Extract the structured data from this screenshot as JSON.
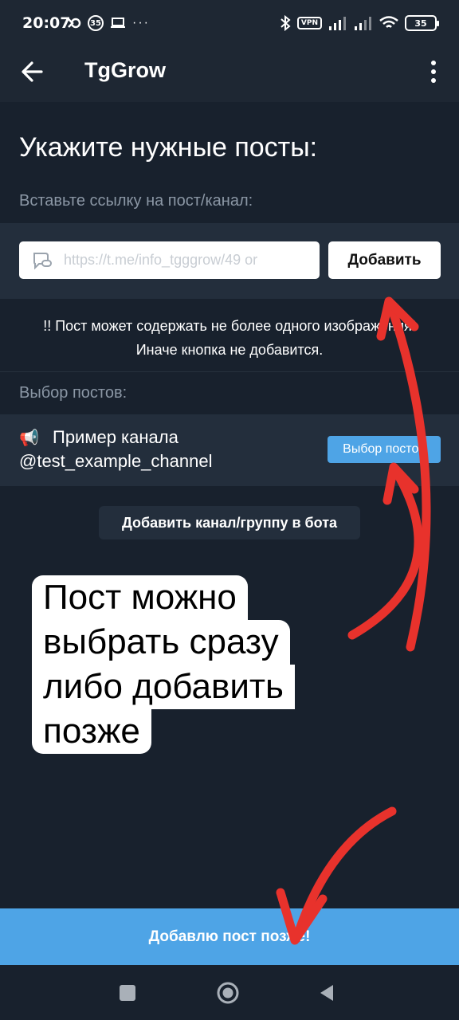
{
  "status_bar": {
    "time": "20:07",
    "circle_badge": "35",
    "vpn": "VPN",
    "battery": "35",
    "more": "···"
  },
  "app_bar": {
    "title": "TgGrow"
  },
  "page": {
    "heading": "Укажите нужные посты:",
    "link_label": "Вставьте ссылку на пост/канал:",
    "link_placeholder": "https://t.me/info_tgggrow/49 or",
    "add_button": "Добавить",
    "notice_line1": "!! Пост может содержать не более одного изображения!",
    "notice_line2": "Иначе кнопка не добавится.",
    "posts_label": "Выбор постов:",
    "channel": {
      "icon": "📢",
      "name": "Пример канала",
      "handle": "@test_example_channel",
      "select_button": "Выбор постов"
    },
    "add_channel_button": "Добавить канал/группу в бота",
    "bottom_button": "Добавлю пост позже!"
  },
  "annotation": {
    "line1": "Пост можно",
    "line2": "выбрать сразу",
    "line3": "либо добавить",
    "line4": "позже",
    "arrow_color": "#e8322c"
  },
  "colors": {
    "background": "#18212d",
    "panel": "#232e3c",
    "accent": "#4ea4e6",
    "muted_text": "#8b97a5"
  }
}
